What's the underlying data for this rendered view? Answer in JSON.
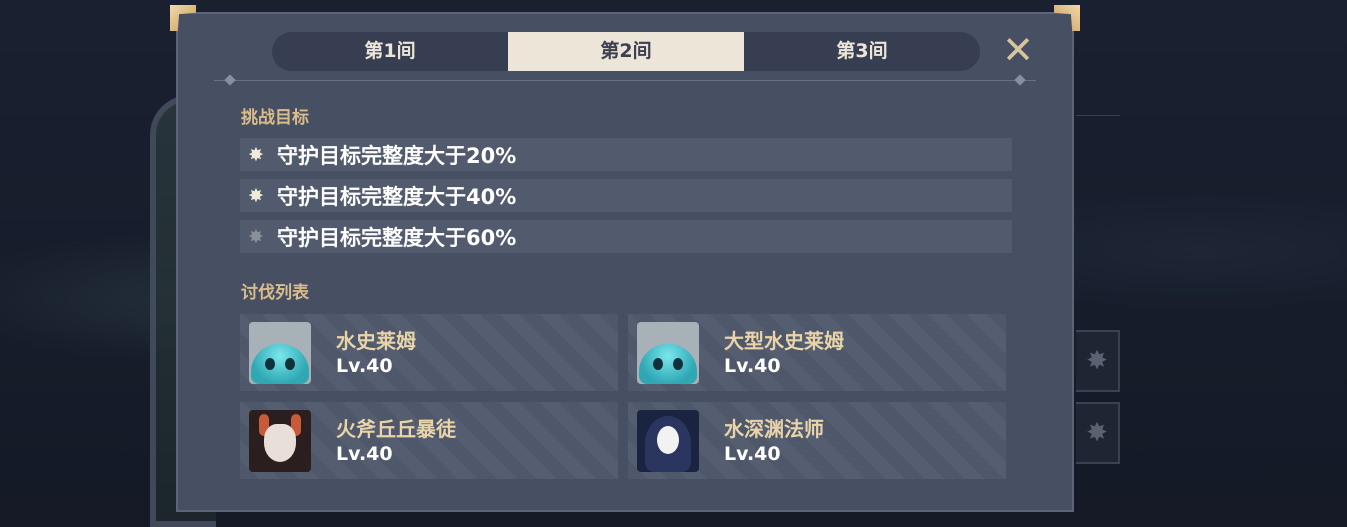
{
  "tabs": [
    {
      "label": "第1间",
      "active": false
    },
    {
      "label": "第2间",
      "active": true
    },
    {
      "label": "第3间",
      "active": false
    }
  ],
  "close_icon": "close-x-icon",
  "challenge": {
    "title": "挑战目标",
    "objectives": [
      {
        "text": "守护目标完整度大于20%",
        "achieved": true,
        "star": "✸"
      },
      {
        "text": "守护目标完整度大于40%",
        "achieved": true,
        "star": "✸"
      },
      {
        "text": "守护目标完整度大于60%",
        "achieved": false,
        "star": "✸"
      }
    ]
  },
  "enemies": {
    "title": "讨伐列表",
    "list": [
      {
        "name": "水史莱姆",
        "level": "Lv.40",
        "portrait": "hydro-slime"
      },
      {
        "name": "大型水史莱姆",
        "level": "Lv.40",
        "portrait": "large-hydro-slime"
      },
      {
        "name": "火斧丘丘暴徒",
        "level": "Lv.40",
        "portrait": "pyro-axe-hilichurl"
      },
      {
        "name": "水深渊法师",
        "level": "Lv.40",
        "portrait": "hydro-abyss-mage"
      }
    ]
  },
  "colors": {
    "panel": "#474f63",
    "tab_active": "#ece5d8",
    "accent_gold": "#d8bd8a"
  }
}
